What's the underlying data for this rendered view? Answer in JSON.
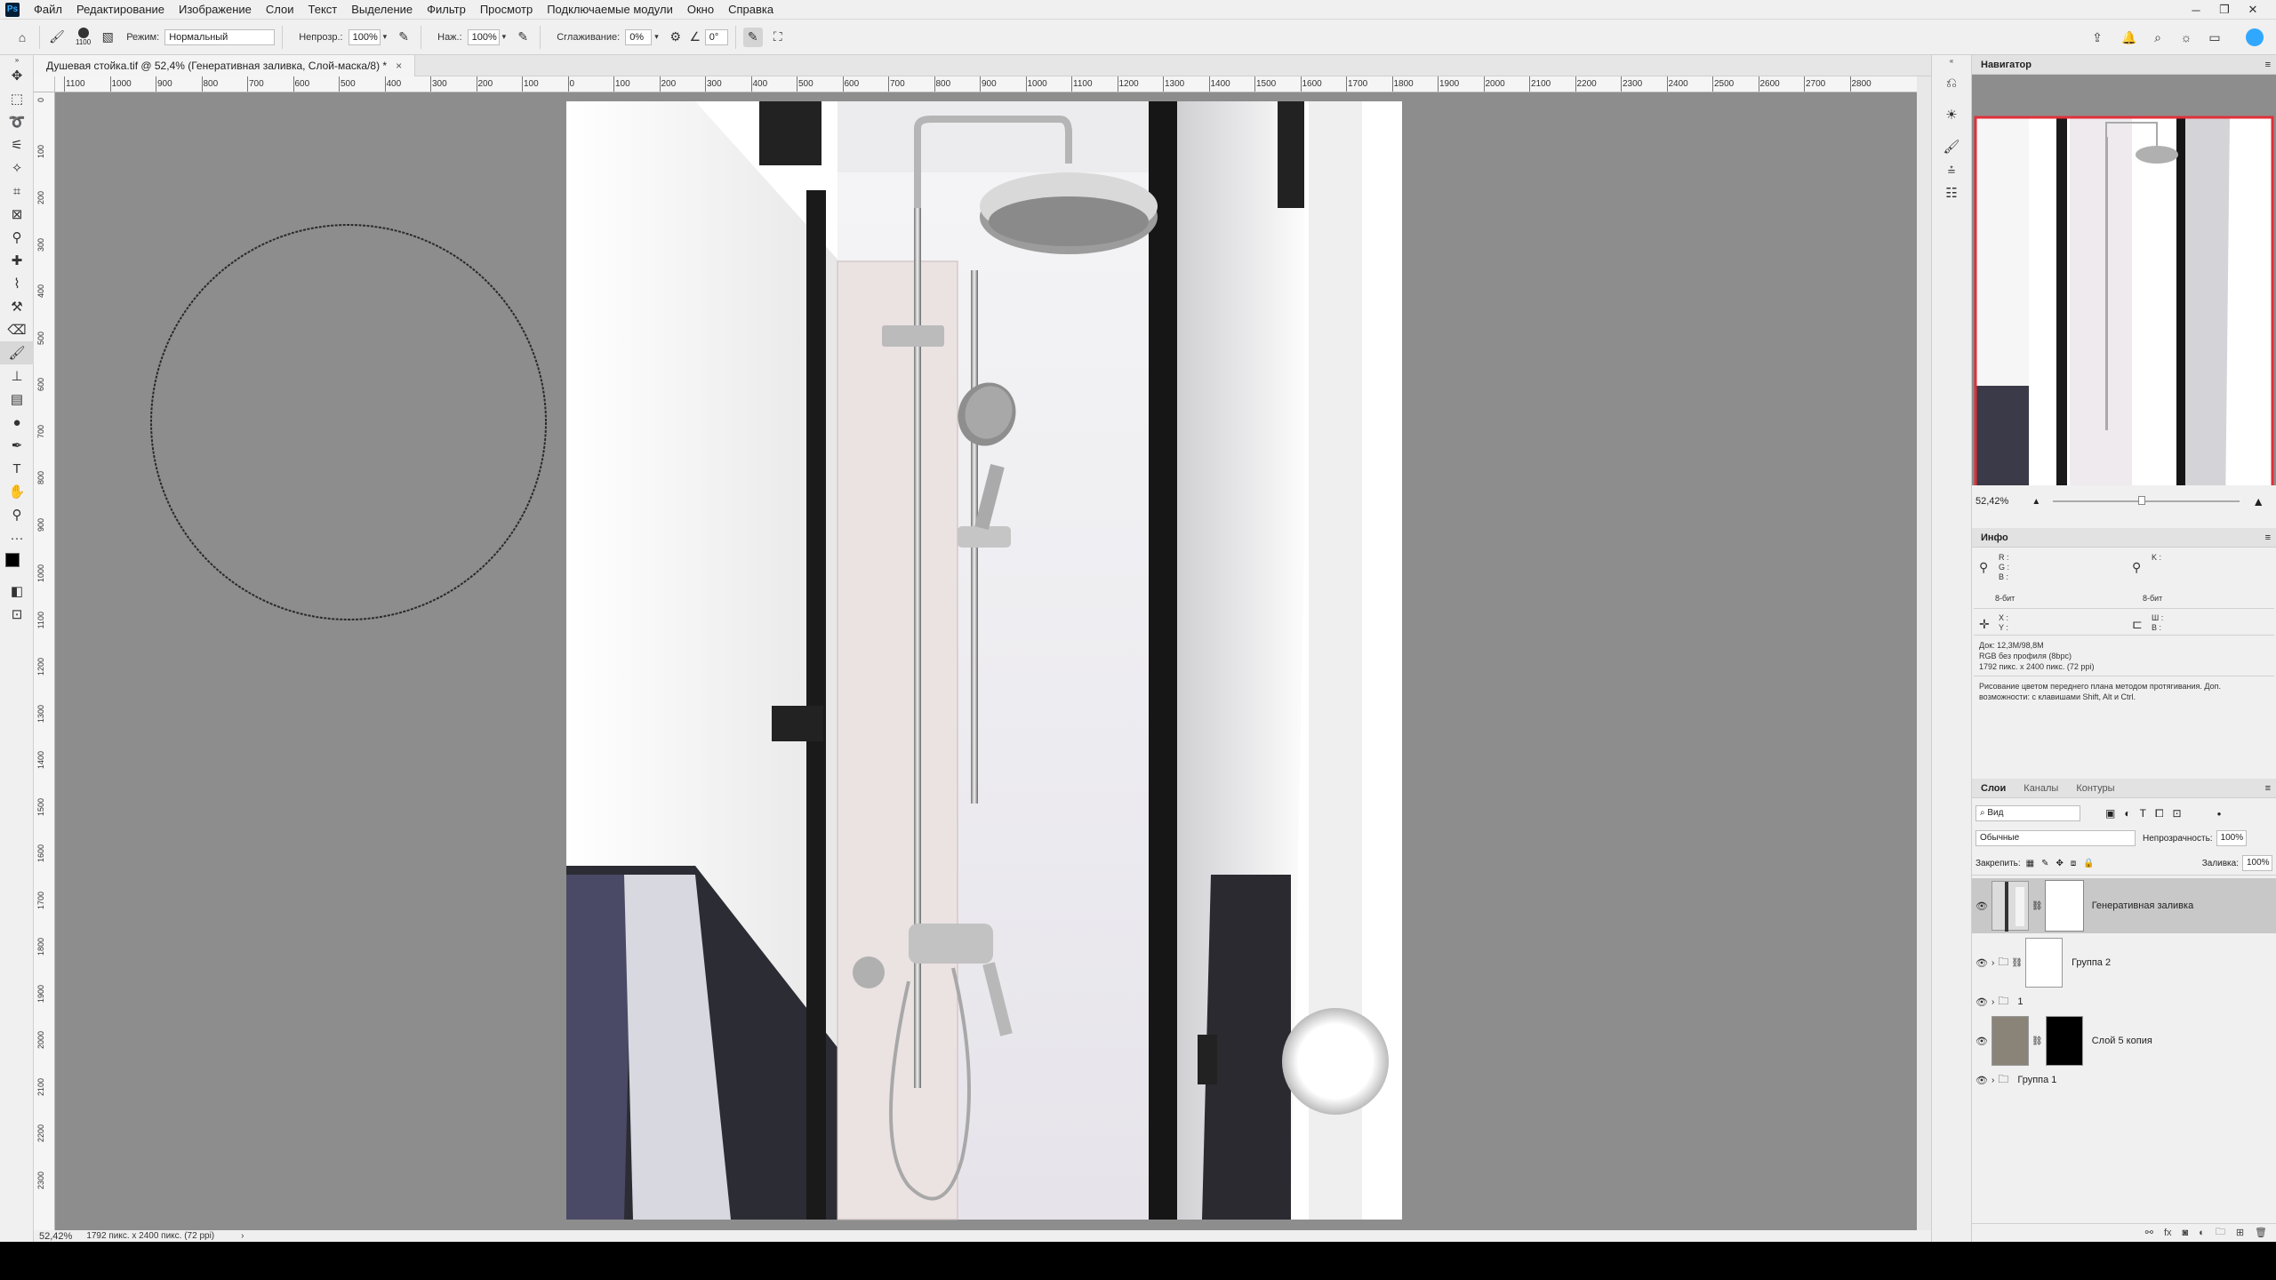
{
  "app": {
    "logo": "Ps"
  },
  "menu": [
    "Файл",
    "Редактирование",
    "Изображение",
    "Слои",
    "Текст",
    "Выделение",
    "Фильтр",
    "Просмотр",
    "Подключаемые модули",
    "Окно",
    "Справка"
  ],
  "options": {
    "brush_size": "1100",
    "mode_label": "Режим:",
    "mode_value": "Нормальный",
    "opacity_label": "Непрозр.:",
    "opacity_value": "100%",
    "pressure_label": "Наж.:",
    "pressure_value": "100%",
    "smoothing_label": "Сглаживание:",
    "smoothing_value": "0%",
    "angle_value": "0°"
  },
  "document": {
    "tab_title": "Душевая стойка.tif @ 52,4% (Генеративная заливка, Слой-маска/8) *",
    "close": "×"
  },
  "ruler_top": [
    "1100",
    "1000",
    "900",
    "800",
    "700",
    "600",
    "500",
    "400",
    "300",
    "200",
    "100",
    "0",
    "100",
    "200",
    "300",
    "400",
    "500",
    "600",
    "700",
    "800",
    "900",
    "1000",
    "1100",
    "1200",
    "1300",
    "1400",
    "1500",
    "1600",
    "1700",
    "1800",
    "1900",
    "2000",
    "2100",
    "2200",
    "2300",
    "2400",
    "2500",
    "2600",
    "2700",
    "2800"
  ],
  "ruler_left": [
    "0",
    "100",
    "200",
    "300",
    "400",
    "500",
    "600",
    "700",
    "800",
    "900",
    "1000",
    "1100",
    "1200",
    "1300",
    "1400",
    "1500",
    "1600",
    "1700",
    "1800",
    "1900",
    "2000",
    "2100",
    "2200",
    "2300"
  ],
  "status": {
    "zoom": "52,42%",
    "info": "1792 пикс. x 2400 пикс. (72 ppi)",
    "arrow": "›"
  },
  "navigator": {
    "title": "Навигатор",
    "zoom": "52,42%"
  },
  "info_panel": {
    "title": "Инфо",
    "rgb": [
      "R :",
      "G :",
      "B :"
    ],
    "bit_left": "8-бит",
    "k": "K :",
    "bit_right": "8-бит",
    "xy": [
      "X :",
      "Y :"
    ],
    "wh": [
      "Ш :",
      "В :"
    ],
    "doc_lines": [
      "Док: 12,3M/98,8M",
      "RGB без профиля (8bpc)",
      "1792 пикс. x 2400 пикс. (72 ppi)"
    ],
    "hint": "Рисование цветом переднего плана методом протягивания. Доп. возможности: с клавишами Shift, Alt и Ctrl."
  },
  "layers_panel": {
    "tabs": [
      "Слои",
      "Каналы",
      "Контуры"
    ],
    "filter": "Вид",
    "blend": "Обычные",
    "opacity_label": "Непрозрачность:",
    "opacity_value": "100%",
    "lock_label": "Закрепить:",
    "fill_label": "Заливка:",
    "fill_value": "100%",
    "layers": [
      {
        "name": "Генеративная заливка"
      },
      {
        "name": "Группа 2"
      },
      {
        "name": "1"
      },
      {
        "name": "Слой 5 копия"
      },
      {
        "name": "Группа 1"
      }
    ]
  },
  "colors": {
    "accent": "#31a8ff",
    "canvas": "#8c8d8c",
    "selected_layer": "#c8c8c8",
    "nav_frame": "#e0303a"
  }
}
